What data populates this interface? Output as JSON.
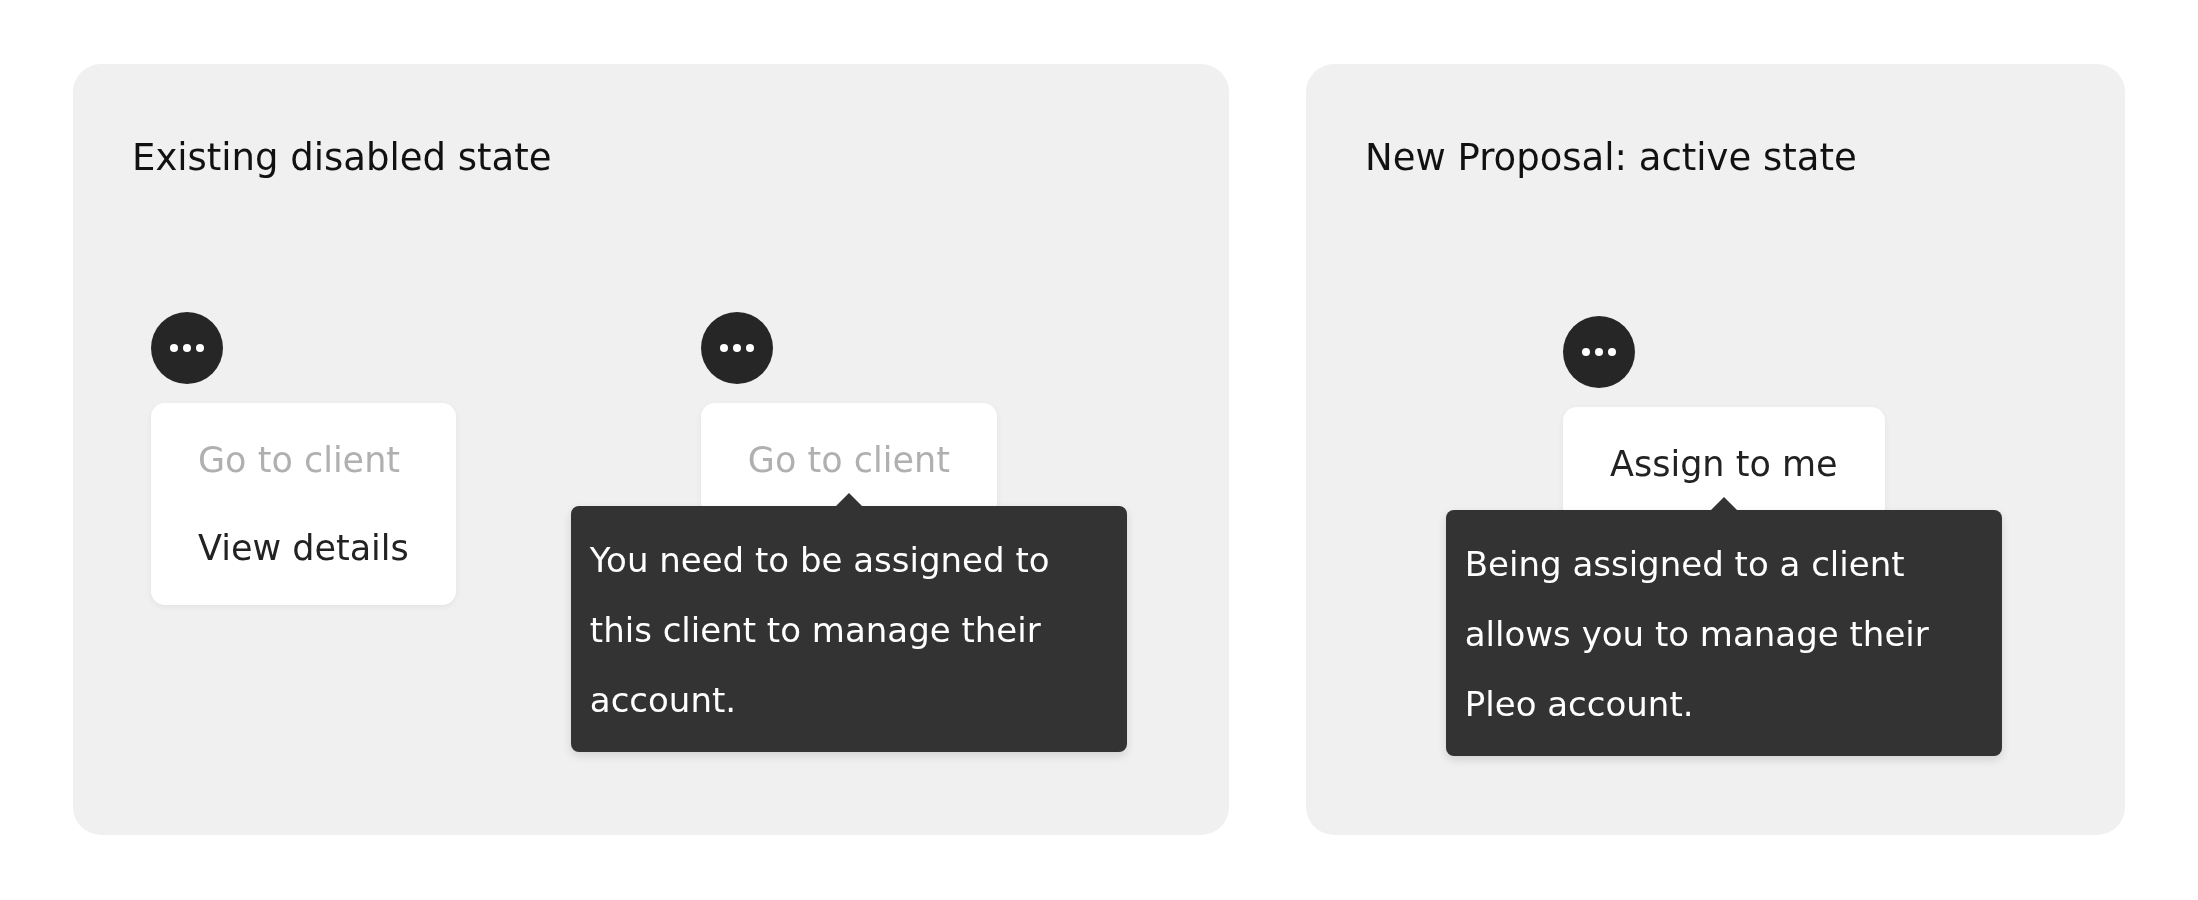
{
  "panels": [
    {
      "title": "Existing disabled state",
      "demos": [
        {
          "items": [
            {
              "label": "Go to client",
              "disabled": true
            },
            {
              "label": "View details",
              "disabled": false
            }
          ]
        },
        {
          "items": [
            {
              "label": "Go to client",
              "disabled": true
            }
          ],
          "tooltip": "You need to be assigned to this client to manage their account."
        }
      ]
    },
    {
      "title": "New Proposal: active state",
      "demos": [
        {
          "items": [
            {
              "label": "Assign to me",
              "disabled": false
            }
          ],
          "tooltip": "Being assigned to a client allows you to manage their Pleo account."
        }
      ]
    }
  ]
}
